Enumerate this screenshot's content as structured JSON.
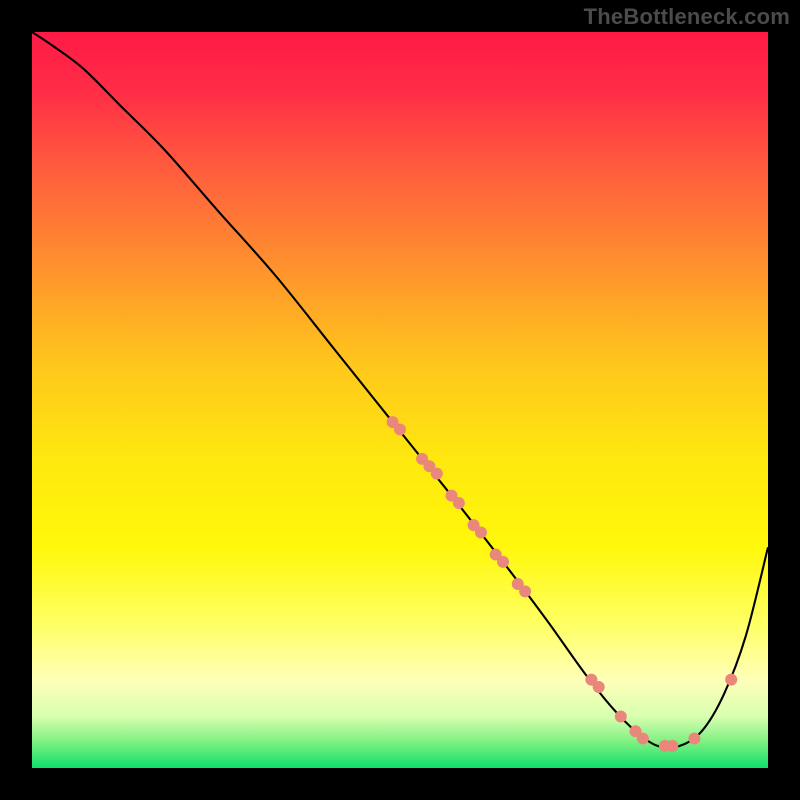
{
  "watermark": "TheBottleneck.com",
  "chart_data": {
    "type": "line",
    "title": "",
    "xlabel": "",
    "ylabel": "",
    "xlim": [
      0,
      100
    ],
    "ylim": [
      0,
      100
    ],
    "background_gradient": {
      "stops": [
        {
          "offset": 0.0,
          "color": "#ff1a46"
        },
        {
          "offset": 0.08,
          "color": "#ff2d46"
        },
        {
          "offset": 0.18,
          "color": "#ff5a3e"
        },
        {
          "offset": 0.3,
          "color": "#ff8a30"
        },
        {
          "offset": 0.45,
          "color": "#ffc61c"
        },
        {
          "offset": 0.58,
          "color": "#ffe80f"
        },
        {
          "offset": 0.7,
          "color": "#fff80a"
        },
        {
          "offset": 0.8,
          "color": "#ffff60"
        },
        {
          "offset": 0.88,
          "color": "#ffffb8"
        },
        {
          "offset": 0.93,
          "color": "#d8ffb0"
        },
        {
          "offset": 0.965,
          "color": "#7cf080"
        },
        {
          "offset": 1.0,
          "color": "#0fe06c"
        }
      ]
    },
    "series": [
      {
        "name": "bottleneck-curve",
        "color": "#000000",
        "x": [
          0,
          3,
          7,
          12,
          18,
          25,
          33,
          41,
          49,
          57,
          64,
          70,
          75,
          79,
          82,
          85,
          88,
          91,
          94,
          97,
          100
        ],
        "y": [
          100,
          98,
          95,
          90,
          84,
          76,
          67,
          57,
          47,
          37,
          28,
          20,
          13,
          8,
          5,
          3,
          3,
          5,
          10,
          18,
          30
        ]
      }
    ],
    "points": {
      "name": "scatter-markers",
      "color": "#e9877a",
      "radius": 6,
      "data": [
        {
          "x": 49,
          "y": 47
        },
        {
          "x": 50,
          "y": 46
        },
        {
          "x": 53,
          "y": 42
        },
        {
          "x": 54,
          "y": 41
        },
        {
          "x": 55,
          "y": 40
        },
        {
          "x": 57,
          "y": 37
        },
        {
          "x": 58,
          "y": 36
        },
        {
          "x": 60,
          "y": 33
        },
        {
          "x": 61,
          "y": 32
        },
        {
          "x": 63,
          "y": 29
        },
        {
          "x": 64,
          "y": 28
        },
        {
          "x": 66,
          "y": 25
        },
        {
          "x": 67,
          "y": 24
        },
        {
          "x": 76,
          "y": 12
        },
        {
          "x": 77,
          "y": 11
        },
        {
          "x": 80,
          "y": 7
        },
        {
          "x": 82,
          "y": 5
        },
        {
          "x": 83,
          "y": 4
        },
        {
          "x": 86,
          "y": 3
        },
        {
          "x": 87,
          "y": 3
        },
        {
          "x": 90,
          "y": 4
        },
        {
          "x": 95,
          "y": 12
        }
      ]
    }
  }
}
